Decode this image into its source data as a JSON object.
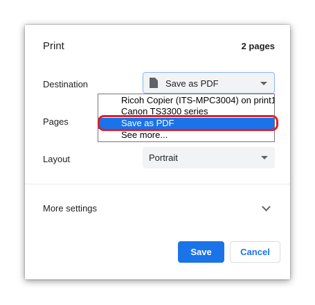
{
  "dialog": {
    "title": "Print",
    "page_count": "2 pages"
  },
  "destination": {
    "label": "Destination",
    "value": "Save as PDF",
    "icon": "document-icon"
  },
  "pages": {
    "label": "Pages"
  },
  "layout": {
    "label": "Layout",
    "value": "Portrait"
  },
  "more_settings": {
    "label": "More settings"
  },
  "buttons": {
    "save": "Save",
    "cancel": "Cancel"
  },
  "dropdown": {
    "options": [
      "Ricoh Copier (ITS-MPC3004) on print1",
      "Canon TS3300 series",
      "Save as PDF",
      "See more..."
    ],
    "selected": "Save as PDF"
  },
  "colors": {
    "accent": "#1a73e8",
    "highlight_ring": "#e01e2b"
  }
}
